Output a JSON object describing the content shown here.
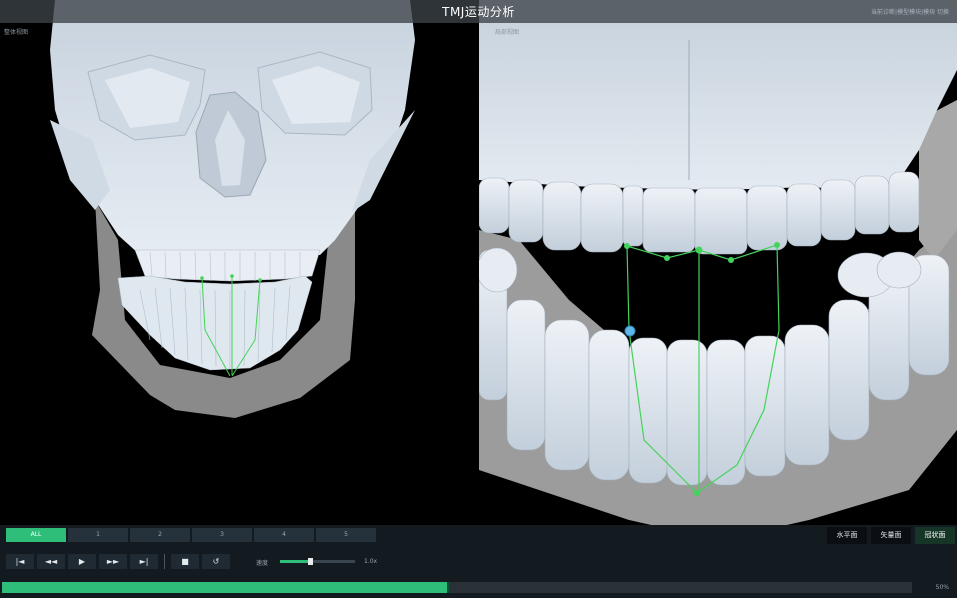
{
  "app": {
    "title": "TMJ运动分析",
    "header_right": "当前诊断|模型模块|模块 切换"
  },
  "views": {
    "left": {
      "label": "整体视图"
    },
    "right": {
      "label": "局部视图"
    }
  },
  "colors": {
    "accent": "#2fbe7a",
    "panel_bg": "#131a20",
    "bone": "#dfe6ee",
    "trajectory": "#44d35a"
  },
  "playback": {
    "tabs": [
      "ALL",
      "1",
      "2",
      "3",
      "4",
      "5"
    ],
    "active_tab": "ALL",
    "buttons": {
      "first": "|◄",
      "rewind": "◄◄",
      "play": "▶",
      "forward": "►►",
      "last": "►|",
      "stop": "■",
      "reset": "↺"
    },
    "speed_label": "速度",
    "speed_value": "1.0x",
    "speed_fraction": 0.4,
    "progress_fraction": 0.49,
    "progress_label": "50%"
  },
  "modes": {
    "horizontal": "水平面",
    "sagittal": "矢量面",
    "coronal": "冠状面",
    "active": "coronal"
  },
  "icons": {
    "first": "skip-to-start-icon",
    "rewind": "rewind-icon",
    "play": "play-icon",
    "forward": "fast-forward-icon",
    "last": "skip-to-end-icon",
    "stop": "stop-icon",
    "reset": "reset-icon"
  }
}
